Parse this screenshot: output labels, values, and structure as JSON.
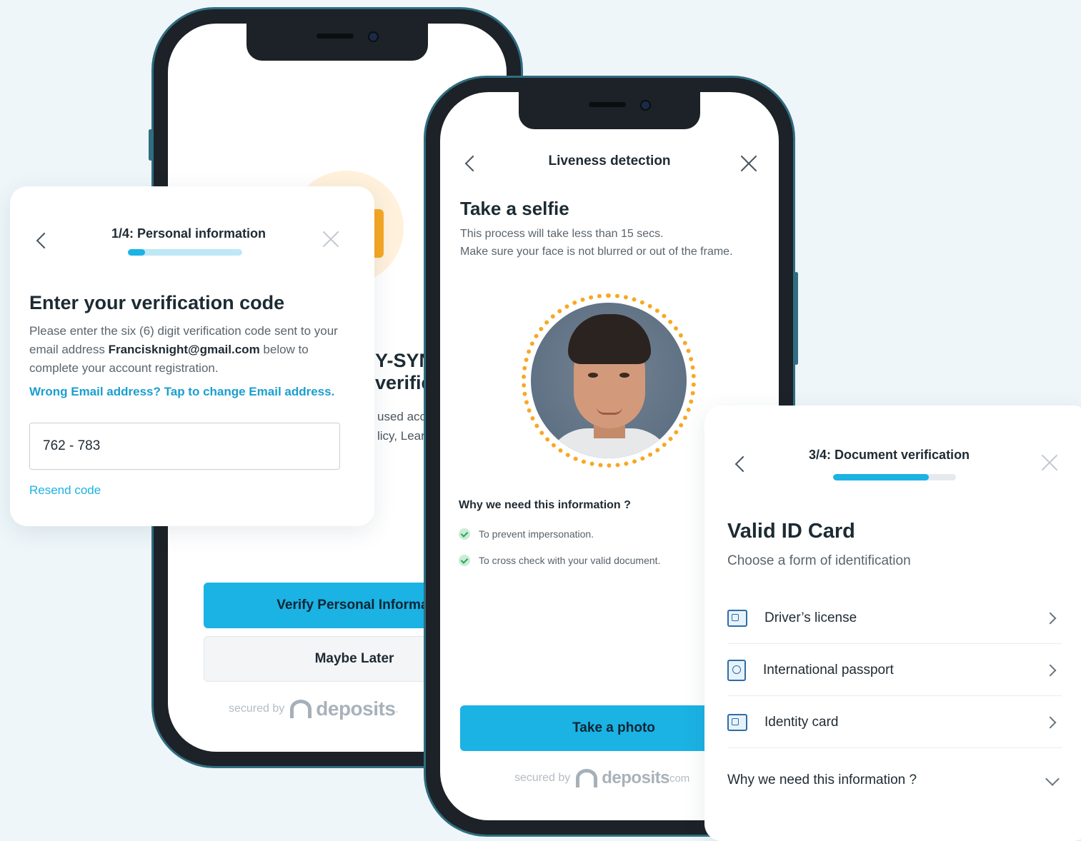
{
  "phone1": {
    "headline_line1": "Y-SYN",
    "headline_line2": "verifie",
    "small_line1": "used accor",
    "small_line2": "licy, Learn n",
    "primary_button": "Verify Personal Informatio",
    "secondary_button": "Maybe Later",
    "secured_by": "secured by",
    "brand": "deposits",
    "brand_tld": "."
  },
  "phone2": {
    "title": "Liveness detection",
    "heading": "Take a selfie",
    "desc_line1": "This process will take less than 15 secs.",
    "desc_line2": "Make sure your face is not blurred or out of the frame.",
    "why_title": "Why we need this information ?",
    "reasons": [
      "To prevent impersonation.",
      "To cross check with your valid document."
    ],
    "primary_button": "Take a photo",
    "secured_by": "secured by",
    "brand": "deposits",
    "brand_tld": "com"
  },
  "card_code": {
    "step_label": "1/4: Personal information",
    "progress": 0.15,
    "heading": "Enter your verification code",
    "text_before": "Please enter the six (6) digit verification code sent to your email address ",
    "email": "Francisknight@gmail.com",
    "text_after": " below to complete your account registration.",
    "change_link": "Wrong Email address? Tap to change Email address.",
    "code_value": "762 - 783",
    "resend": "Resend code"
  },
  "card_doc": {
    "step_label": "3/4: Document verification",
    "progress": 0.78,
    "heading": "Valid ID Card",
    "subheading": "Choose a form of identification",
    "options": [
      {
        "label": "Driver’s license",
        "icon": "drivers-license-icon"
      },
      {
        "label": "International passport",
        "icon": "passport-icon"
      },
      {
        "label": "Identity card",
        "icon": "identity-card-icon"
      }
    ],
    "why_label": "Why we need this information ?"
  },
  "colors": {
    "accent": "#1bb2e4",
    "link": "#1a9fd0",
    "phone_frame": "#2f6d80",
    "selfie_ring": "#f7a823",
    "background": "#eef6f9"
  }
}
